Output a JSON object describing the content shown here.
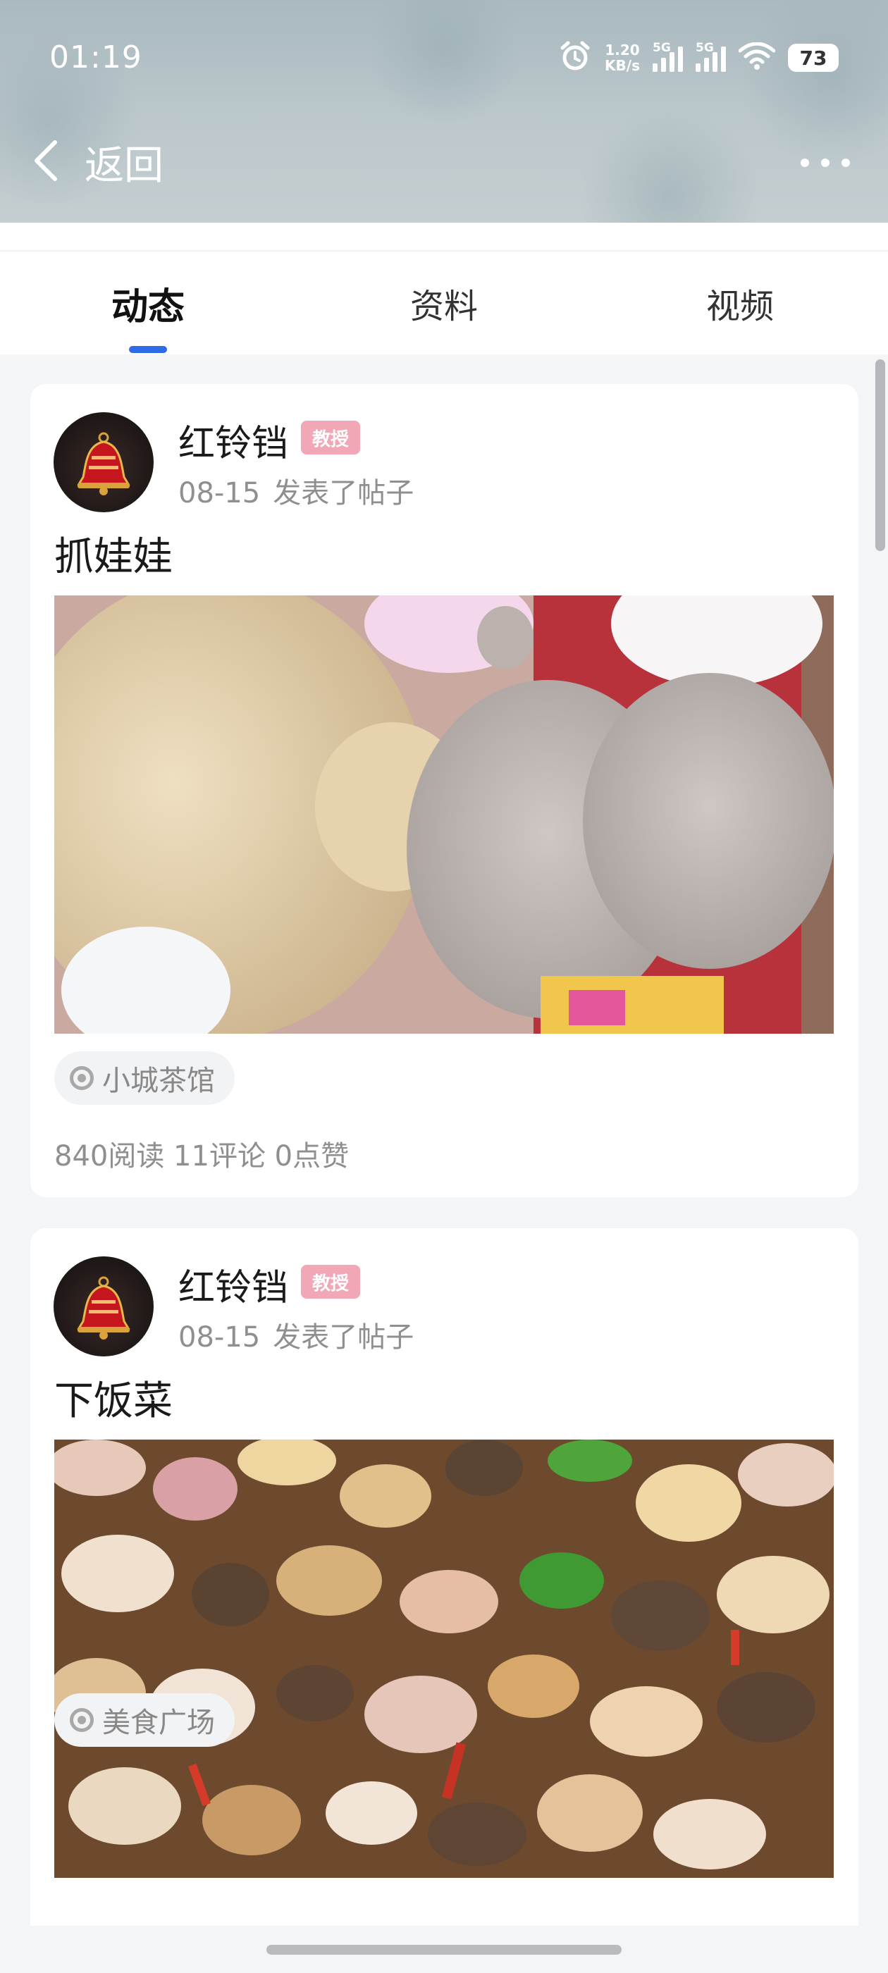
{
  "status_bar": {
    "time": "01:19",
    "net_speed_value": "1.20",
    "net_speed_unit": "KB/s",
    "signal1_label": "5G",
    "signal2_label": "5G",
    "battery": "73",
    "icons": [
      "alarm-icon",
      "signal-icon",
      "signal-icon",
      "wifi-icon",
      "battery-icon"
    ]
  },
  "nav": {
    "back_label": "返回",
    "more_icon": "more-icon"
  },
  "tabs": [
    {
      "label": "动态",
      "active": true
    },
    {
      "label": "资料",
      "active": false
    },
    {
      "label": "视频",
      "active": false
    }
  ],
  "colors": {
    "accent": "#2e6be6",
    "badge": "#f2a7b6",
    "header": "#b4c2c7"
  },
  "posts": [
    {
      "username": "红铃铛",
      "badge": "教授",
      "date": "08-15",
      "action": "发表了帖子",
      "title": "抓娃娃",
      "location": "小城茶馆",
      "stats": "840阅读 11评论 0点赞"
    },
    {
      "username": "红铃铛",
      "badge": "教授",
      "date": "08-15",
      "action": "发表了帖子",
      "title": "下饭菜",
      "location": "美食广场"
    }
  ]
}
